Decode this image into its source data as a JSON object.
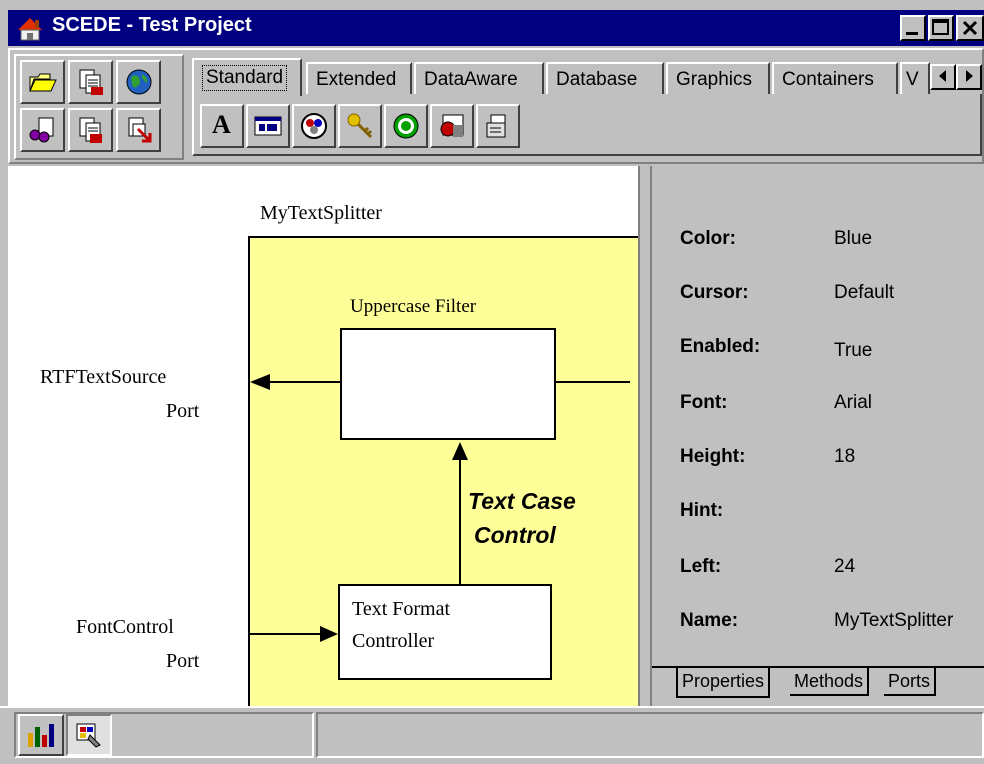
{
  "window": {
    "title": "SCEDE - Test Project"
  },
  "palette_tabs": [
    "Standard",
    "Extended",
    "DataAware",
    "Database",
    "Graphics",
    "Containers",
    "V"
  ],
  "palette_icons": [
    "text-label-icon",
    "edit-box-icon",
    "radio-icon",
    "key-icon",
    "target-icon",
    "image-icon",
    "panel-icon"
  ],
  "diagram": {
    "component_name": "MyTextSplitter",
    "filter_label": "Uppercase Filter",
    "source_port_line1": "RTFTextSource",
    "source_port_line2": "Port",
    "control_label_line1": "Text Case",
    "control_label_line2": "Control",
    "controller_line1": "Text Format",
    "controller_line2": "Controller",
    "font_port_line1": "FontControl",
    "font_port_line2": "Port",
    "component_fill": "#ffff99"
  },
  "properties": [
    {
      "label": "Color:",
      "value": "Blue"
    },
    {
      "label": "Cursor:",
      "value": "Default"
    },
    {
      "label": "Enabled:",
      "value": "True"
    },
    {
      "label": "Font:",
      "value": "Arial"
    },
    {
      "label": "Height:",
      "value": "18"
    },
    {
      "label": "Hint:",
      "value": ""
    },
    {
      "label": "Left:",
      "value": "24"
    },
    {
      "label": "Name:",
      "value": "MyTextSplitter"
    }
  ],
  "bottom_tabs": [
    "Properties",
    "Methods",
    "Ports"
  ],
  "colors": {
    "titlebar": "#000080",
    "face": "#c0c0c0",
    "component": "#ffff99"
  }
}
